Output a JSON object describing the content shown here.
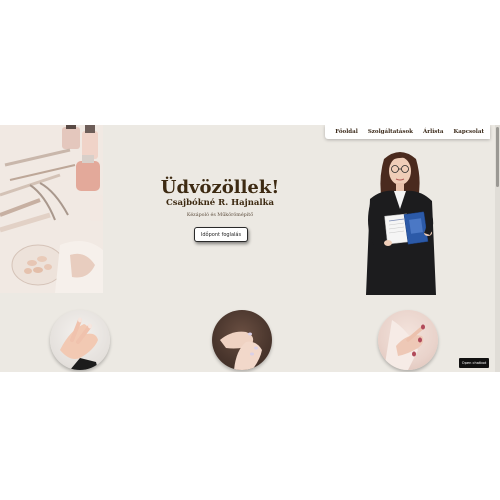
{
  "nav": {
    "items": [
      {
        "label": "Főoldal"
      },
      {
        "label": "Szolgáltatások"
      },
      {
        "label": "Árlista"
      },
      {
        "label": "Kapcsolat"
      }
    ]
  },
  "hero": {
    "title": "Üdvözöllek!",
    "name": "Csajbókné R. Hajnalka",
    "tagline": "Kézápoló és Műkörömépítő",
    "button_label": "Időpont foglalás"
  },
  "chat": {
    "label": "Open chatbot"
  },
  "colors": {
    "page_background": "#ece9e3",
    "heading": "#3d2a12",
    "nav_text": "#3b2a1a"
  }
}
